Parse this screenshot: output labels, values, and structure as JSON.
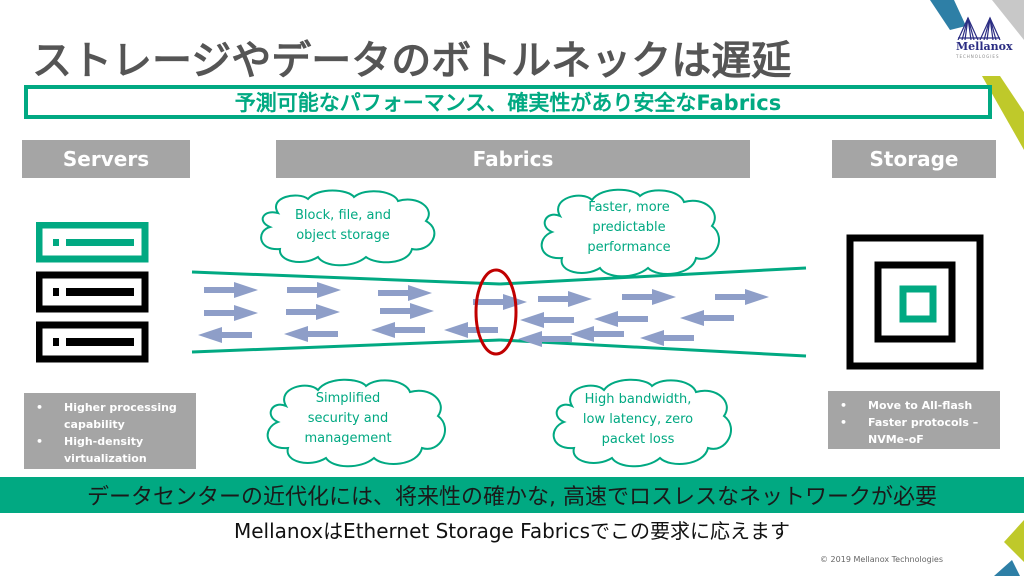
{
  "slide": {
    "title": "ストレージやデータのボトルネックは遅延",
    "subtitle": "予測可能なパフォーマンス、確実性があり安全なFabrics",
    "columns": {
      "servers": "Servers",
      "fabrics": "Fabrics",
      "storage": "Storage"
    },
    "servers_bullets": [
      "Higher processing capability",
      "High-density virtualization"
    ],
    "storage_bullets": [
      "Move to All-flash",
      "Faster protocols – NVMe-oF"
    ],
    "clouds": {
      "top_left": "Block, file, and object storage",
      "top_right": "Faster, more predictable performance",
      "bottom_left": "Simplified security and management",
      "bottom_right": "High bandwidth, low latency, zero packet loss"
    },
    "banner": "データセンターの近代化には、将来性の確かな, 高速でロスレスなネットワークが必要",
    "tagline": "MellanoxはEthernet Storage Fabricsでこの要求に応えます",
    "copyright": "© 2019 Mellanox Technologies",
    "logo": {
      "name": "Mellanox",
      "sub": "TECHNOLOGIES"
    }
  },
  "colors": {
    "accent_green": "#01a982",
    "header_gray": "#a5a5a5",
    "arrow_blue": "#8e9ec8",
    "bottleneck_red": "#c00000",
    "title_gray": "#555555",
    "deco_blue": "#2e7fa6",
    "deco_lime": "#bfc92a",
    "deco_gray": "#c8c8c8",
    "logo_navy": "#2b2d83"
  }
}
